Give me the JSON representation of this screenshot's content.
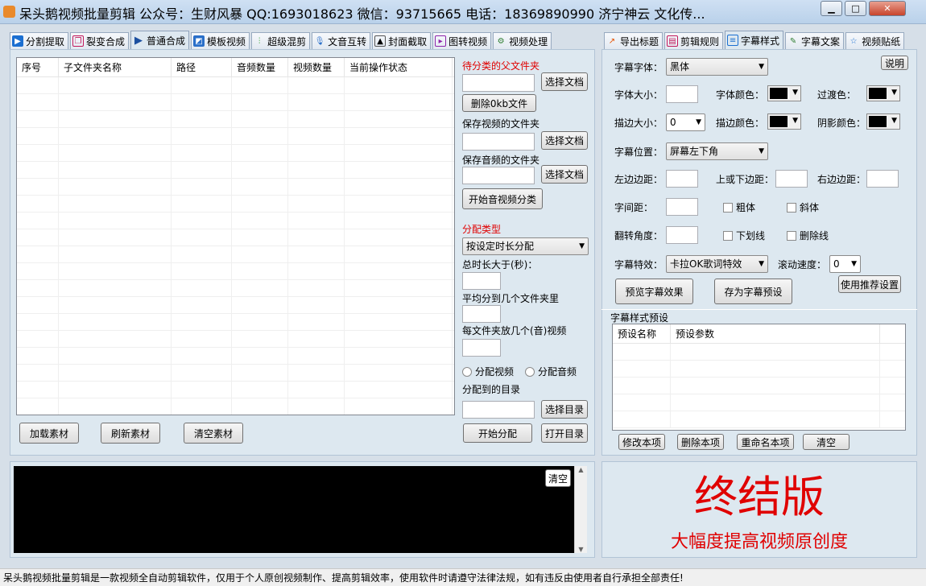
{
  "window": {
    "title": "呆头鹅视频批量剪辑 公众号：生财风暴 QQ:1693018623 微信：93715665 电话：18369890990 济宁神云 文化传...",
    "minimize_glyph": "▁",
    "maximize_glyph": "□",
    "close_glyph": "✕"
  },
  "left_tabs": [
    {
      "label": "分割提取",
      "icon": "play-box-icon"
    },
    {
      "label": "裂变合成",
      "icon": "copy-icon"
    },
    {
      "label": "普通合成",
      "icon": "play-arrow-icon"
    },
    {
      "label": "模板视频",
      "icon": "template-icon"
    },
    {
      "label": "超级混剪",
      "icon": "audio-wave-icon"
    },
    {
      "label": "文音互转",
      "icon": "microphone-icon"
    },
    {
      "label": "封面截取",
      "icon": "image-icon"
    },
    {
      "label": "图转视频",
      "icon": "film-icon"
    },
    {
      "label": "视频处理",
      "icon": "tools-icon"
    }
  ],
  "right_tabs": [
    {
      "label": "导出标题",
      "icon": "export-icon"
    },
    {
      "label": "剪辑规则",
      "icon": "rules-icon"
    },
    {
      "label": "字幕样式",
      "icon": "document-icon"
    },
    {
      "label": "字幕文案",
      "icon": "edit-icon"
    },
    {
      "label": "视频贴纸",
      "icon": "star-icon"
    }
  ],
  "file_table": {
    "columns": [
      "序号",
      "子文件夹名称",
      "路径",
      "音频数量",
      "视频数量",
      "当前操作状态"
    ],
    "rows": []
  },
  "left_buttons": {
    "load": "加载素材",
    "refresh": "刷新素材",
    "clear": "清空素材"
  },
  "classify": {
    "parent_label": "待分类的父文件夹",
    "select_doc": "选择文档",
    "delete_zero": "删除0kb文件",
    "save_video_label": "保存视频的文件夹",
    "save_audio_label": "保存音频的文件夹",
    "start_classify": "开始音视频分类"
  },
  "distribute": {
    "type_label": "分配类型",
    "type_value": "按设定时长分配",
    "total_duration_label": "总时长大于(秒)：",
    "avg_folders_label": "平均分到几个文件夹里",
    "per_folder_label": "每文件夹放几个(音)视频",
    "radio_video": "分配视频",
    "radio_audio": "分配音频",
    "target_dir_label": "分配到的目录",
    "select_dir": "选择目录",
    "start": "开始分配",
    "open_dir": "打开目录"
  },
  "subtitle": {
    "help": "说明",
    "font_label": "字幕字体：",
    "font_value": "黑体",
    "size_label": "字体大小：",
    "size_value": "",
    "font_color_label": "字体颜色：",
    "transition_label": "过渡色：",
    "stroke_size_label": "描边大小：",
    "stroke_size_value": "0",
    "stroke_color_label": "描边颜色：",
    "shadow_color_label": "阴影颜色：",
    "position_label": "字幕位置：",
    "position_value": "屏幕左下角",
    "left_margin_label": "左边边距：",
    "vert_margin_label": "上或下边距：",
    "right_margin_label": "右边边距：",
    "spacing_label": "字间距：",
    "bold": "粗体",
    "italic": "斜体",
    "rotate_label": "翻转角度：",
    "underline": "下划线",
    "strikethrough": "删除线",
    "effect_label": "字幕特效：",
    "effect_value": "卡拉OK歌词特效",
    "scroll_label": "滚动速度：",
    "scroll_value": "0",
    "preview": "预览字幕效果",
    "save_preset": "存为字幕预设",
    "use_recommended": "使用推荐设置",
    "colors": {
      "font": "#000000",
      "transition": "#000000",
      "stroke": "#000000",
      "shadow": "#000000"
    }
  },
  "presets": {
    "group_label": "字幕样式预设",
    "columns": [
      "预设名称",
      "预设参数"
    ],
    "rows": [],
    "modify": "修改本项",
    "delete": "删除本项",
    "rename": "重命名本项",
    "clear": "清空"
  },
  "log": {
    "clear": "清空"
  },
  "promo": {
    "headline": "终结版",
    "subline": "大幅度提高视频原创度",
    "color": "#e00000"
  },
  "status_bar": "呆头鹅视频批量剪辑是一款视频全自动剪辑软件，仅用于个人原创视频制作、提高剪辑效率，使用软件时请遵守法律法规，如有违反由使用者自行承担全部责任!"
}
